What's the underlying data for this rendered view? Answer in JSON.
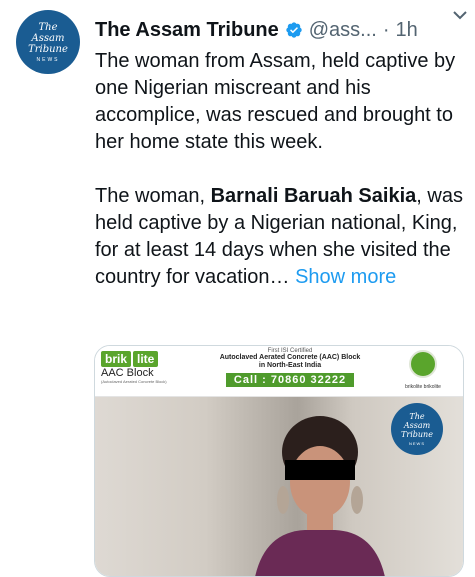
{
  "tweet": {
    "account_name": "The Assam Tribune",
    "handle": "@ass...",
    "separator": "·",
    "time": "1h",
    "paragraph1": "The woman from Assam, held captive by one Nigerian miscreant and his accomplice, was rescued and brought to her home state this week.",
    "paragraph2_prefix": "The woman, ",
    "paragraph2_bold": "Barnali Baruah Saikia",
    "paragraph2_suffix": ", was held captive by a Nigerian national, King, for at least 14 days when she visited the country for vacation…",
    "show_more": "Show more"
  },
  "avatar": {
    "line1": "The",
    "line2": "Assam",
    "line3": "Tribune",
    "line4": "NEWS"
  },
  "ad": {
    "brand_left": "brik",
    "brand_right": "lite",
    "product": "AAC Block",
    "product_sub": "(Autoclaved Aerated Concrete Block)",
    "certified": "First ISI Certified",
    "headline_line1": "Autoclaved Aerated Concrete (AAC) Block",
    "headline_line2": "in North-East India",
    "call": "Call : 70860 32222",
    "social": "brikolite  brikolite"
  },
  "photo_stamp": {
    "line1": "The",
    "line2": "Assam",
    "line3": "Tribune",
    "line4": "NEWS"
  },
  "colors": {
    "link": "#1d9bf0",
    "muted": "#536471",
    "brand_blue": "#1a5c92",
    "ad_green": "#4f9b2c"
  },
  "icons": {
    "verified": "verified-badge-icon",
    "more": "more-options-icon"
  }
}
